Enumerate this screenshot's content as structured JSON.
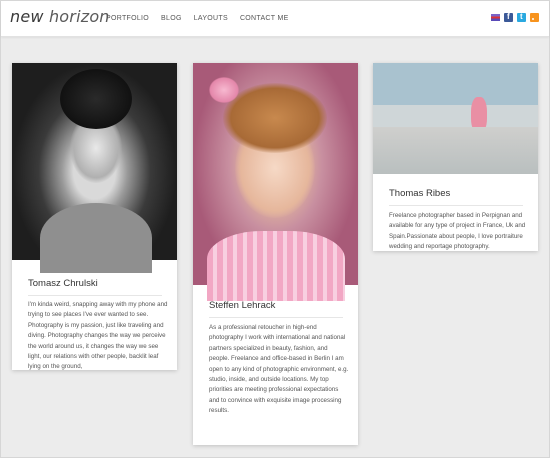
{
  "header": {
    "logo_prefix": "new ",
    "logo_suffix": "horizon",
    "nav": [
      "PORTFOLIO",
      "BLOG",
      "LAYOUTS",
      "CONTACT ME"
    ]
  },
  "cards": [
    {
      "name": "Tomasz Chrulski",
      "bio": "I'm kinda weird, snapping away with my phone and trying to see places I've ever wanted to see. Photography is my passion, just like traveling and diving. Photography changes the way we perceive the world around us, it changes the way we see light, our relations with other people, backlit leaf lying on the ground,"
    },
    {
      "name": "Steffen Lehrack",
      "bio": "As a professional retoucher in high-end photography I work with international and national partners specialized in beauty, fashion, and people. Freelance and office-based in Berlin I am open to any kind of photographic environment, e.g. studio, inside, and outside locations. My top priorities are meeting professional expectations and to convince with exquisite image processing results."
    },
    {
      "name": "Thomas Ribes",
      "bio": "Freelance photographer based in Perpignan and available for any type of project in France, Uk and Spain.Passionate about people, I love portraiture wedding and reportage photography."
    }
  ],
  "icons": [
    "flag-icon",
    "facebook-icon",
    "twitter-icon",
    "rss-icon"
  ],
  "colors": {
    "background": "#ececec",
    "card": "#ffffff",
    "text": "#444444"
  }
}
